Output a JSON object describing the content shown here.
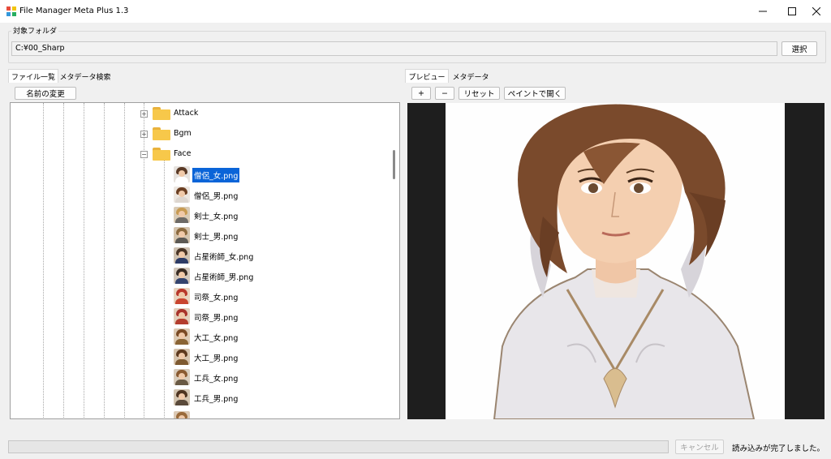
{
  "window": {
    "title": "File Manager Meta Plus 1.3",
    "controls": [
      "minimize",
      "maximize",
      "close"
    ]
  },
  "folder_group": {
    "label": "対象フォルダ",
    "path": "C:¥00_Sharp",
    "select_button": "選択"
  },
  "left_tabs": [
    {
      "label": "ファイル一覧",
      "active": true
    },
    {
      "label": "メタデータ検索",
      "active": false
    }
  ],
  "rename_button": "名前の変更",
  "tree": {
    "folders": [
      {
        "label": "Attack",
        "expanded": false
      },
      {
        "label": "Bgm",
        "expanded": false
      },
      {
        "label": "Face",
        "expanded": true
      }
    ],
    "files": [
      {
        "label": "僧侶_女.png",
        "selected": true
      },
      {
        "label": "僧侶_男.png",
        "selected": false
      },
      {
        "label": "剣士_女.png",
        "selected": false
      },
      {
        "label": "剣士_男.png",
        "selected": false
      },
      {
        "label": "占星術師_女.png",
        "selected": false
      },
      {
        "label": "占星術師_男.png",
        "selected": false
      },
      {
        "label": "司祭_女.png",
        "selected": false
      },
      {
        "label": "司祭_男.png",
        "selected": false
      },
      {
        "label": "大工_女.png",
        "selected": false
      },
      {
        "label": "大工_男.png",
        "selected": false
      },
      {
        "label": "工兵_女.png",
        "selected": false
      },
      {
        "label": "工兵_男.png",
        "selected": false
      }
    ]
  },
  "right_tabs": [
    {
      "label": "プレビュー",
      "active": true
    },
    {
      "label": "メタデータ",
      "active": false
    }
  ],
  "preview_toolbar": {
    "zoom_in": "+",
    "zoom_out": "−",
    "reset": "リセット",
    "open_in_paint": "ペイントで開く"
  },
  "footer": {
    "cancel_button": "キャンセル",
    "status": "読み込みが完了しました。"
  },
  "colors": {
    "selection": "#0a64d8",
    "folder": "#f7c84a",
    "preview_background": "#1e1e1e"
  }
}
